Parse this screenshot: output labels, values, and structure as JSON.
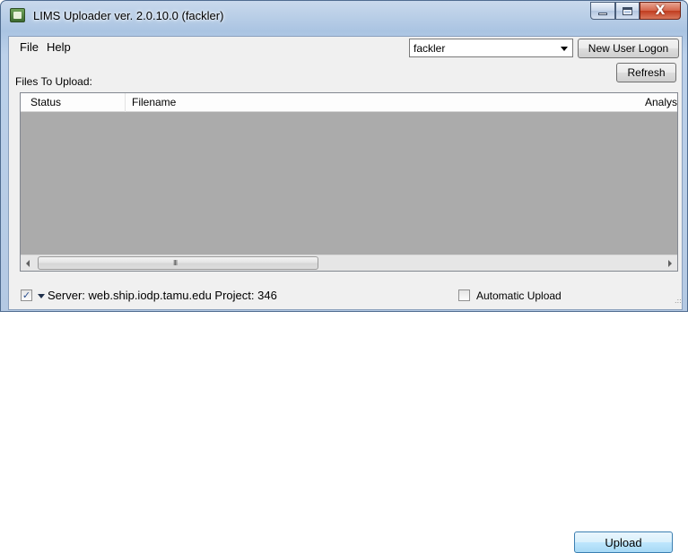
{
  "window": {
    "title": "LIMS Uploader ver. 2.0.10.0  (fackler)",
    "app_icon": "lims-uploader-app-icon",
    "controls": {
      "minimize": "minimize-icon",
      "maximize": "maximize-icon",
      "close": "close-icon"
    },
    "close_glyph": "X"
  },
  "menu": {
    "file": "File",
    "help": "Help"
  },
  "user": {
    "selected": "fackler",
    "new_logon_label": "New User Logon"
  },
  "files": {
    "label": "Files To Upload:",
    "refresh_label": "Refresh",
    "columns": [
      "Status",
      "Filename",
      "Analys"
    ],
    "rows": []
  },
  "scrollbar": {
    "grip": "III"
  },
  "status": {
    "server_checked": true,
    "check_glyph": "✓",
    "server_text": "Server: web.ship.iodp.tamu.edu  Project: 346",
    "auto_upload_label": "Automatic Upload",
    "auto_upload_checked": false,
    "upload_label": "Upload"
  },
  "colors": {
    "list_background": "#ababab",
    "title_gradient": "#aac4e2",
    "upload_button": "#bee6fd"
  }
}
